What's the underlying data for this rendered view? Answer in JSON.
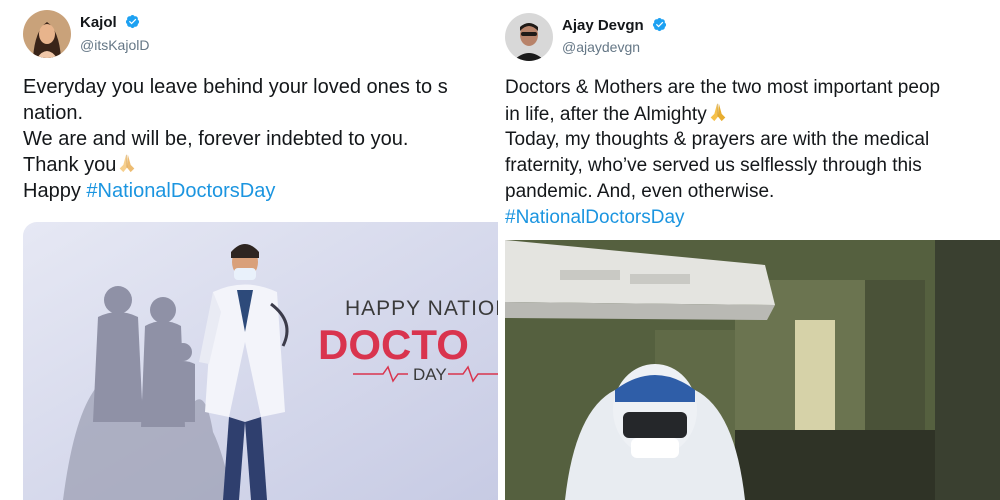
{
  "left_tweet": {
    "author_name": "Kajol",
    "handle": "@itsKajolD",
    "lines": [
      "Everyday you leave behind your loved ones to s",
      "nation.",
      "We are and will be, forever indebted to you.",
      "Thank you"
    ],
    "happy_prefix": "Happy ",
    "hashtag": "#NationalDoctorsDay",
    "image": {
      "headline": "HAPPY NATIONA",
      "big_word": "DOCTO",
      "sub_word": "DAY"
    }
  },
  "right_tweet": {
    "author_name": "Ajay Devgn",
    "handle": "@ajaydevgn",
    "lines": [
      "Doctors & Mothers are the two most important peop",
      "in life, after the Almighty",
      "Today, my thoughts & prayers are with the medical",
      "fraternity, who’ve served us selflessly through this",
      "pandemic. And, even otherwise."
    ],
    "hashtag": "#NationalDoctorsDay"
  },
  "colors": {
    "hashtag": "#1b95e0",
    "verified": "#1da1f2",
    "doctor_red": "#d9344e",
    "poster_bg": "#dcdff0"
  }
}
